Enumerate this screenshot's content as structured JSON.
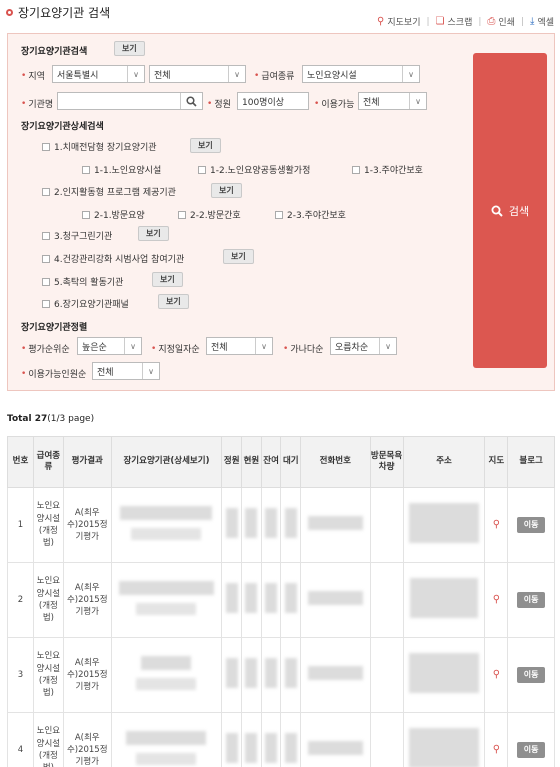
{
  "header": {
    "title": "장기요양기관 검색",
    "links": [
      {
        "label": "지도보기"
      },
      {
        "label": "스크랩"
      },
      {
        "label": "인쇄"
      },
      {
        "label": "엑셀"
      }
    ]
  },
  "basic_search": {
    "heading": "장기요양기관검색",
    "view_label": "보기",
    "region_label": "지역",
    "region_value": "서울특별시",
    "district_value": "전체",
    "benefit_label": "급여종류",
    "benefit_value": "노인요양시설",
    "name_label": "기관명",
    "name_value": "",
    "capacity_label": "정원",
    "capacity_value": "100명이상",
    "available_label": "이용가능",
    "available_value": "전체"
  },
  "detail_search": {
    "heading": "장기요양기관상세검색",
    "view_label": "보기",
    "items": [
      {
        "label": "1.치매전담형 장기요양기관"
      },
      {
        "label": "1-1.노인요양시설"
      },
      {
        "label": "1-2.노인요양공동생활가정"
      },
      {
        "label": "1-3.주야간보호"
      },
      {
        "label": "2.인지활동형 프로그램 제공기관"
      },
      {
        "label": "2-1.방문요양"
      },
      {
        "label": "2-2.방문간호"
      },
      {
        "label": "2-3.주야간보호"
      },
      {
        "label": "3.청구그린기관"
      },
      {
        "label": "4.건강관리강화 시범사업 참여기관"
      },
      {
        "label": "5.촉탁의 활동기관"
      },
      {
        "label": "6.장기요양기관패널"
      }
    ]
  },
  "sort": {
    "heading": "장기요양기관정렬",
    "eval_label": "평가순위순",
    "eval_value": "높은순",
    "date_label": "지정일자순",
    "date_value": "전체",
    "alpha_label": "가나다순",
    "alpha_value": "오름차순",
    "avail_label": "이용가능인원순",
    "avail_value": "전체"
  },
  "search_button": "검색",
  "total": {
    "label": "Total 27",
    "page": "(1/3 page)"
  },
  "table": {
    "headers": [
      "번호",
      "급여종류",
      "평가결과",
      "장기요양기관(상세보기)",
      "정원",
      "현원",
      "잔여",
      "대기",
      "전화번호",
      "방문목욕차량",
      "주소",
      "지도",
      "블로그"
    ],
    "rows": [
      {
        "no": "1",
        "type": "노인요양시설(개정법)",
        "eval": "A(최우수)2015정기평가",
        "blog": "이동"
      },
      {
        "no": "2",
        "type": "노인요양시설(개정법)",
        "eval": "A(최우수)2015정기평가",
        "blog": "이동"
      },
      {
        "no": "3",
        "type": "노인요양시설(개정법)",
        "eval": "A(최우수)2015정기평가",
        "blog": "이동"
      },
      {
        "no": "4",
        "type": "노인요양시설(개정법)",
        "eval": "A(최우수)2015정기평가",
        "blog": "이동"
      }
    ]
  },
  "colors": {
    "accent": "#dc5750",
    "panel_bg": "#fdf2ef",
    "panel_border": "#eec6bf"
  }
}
